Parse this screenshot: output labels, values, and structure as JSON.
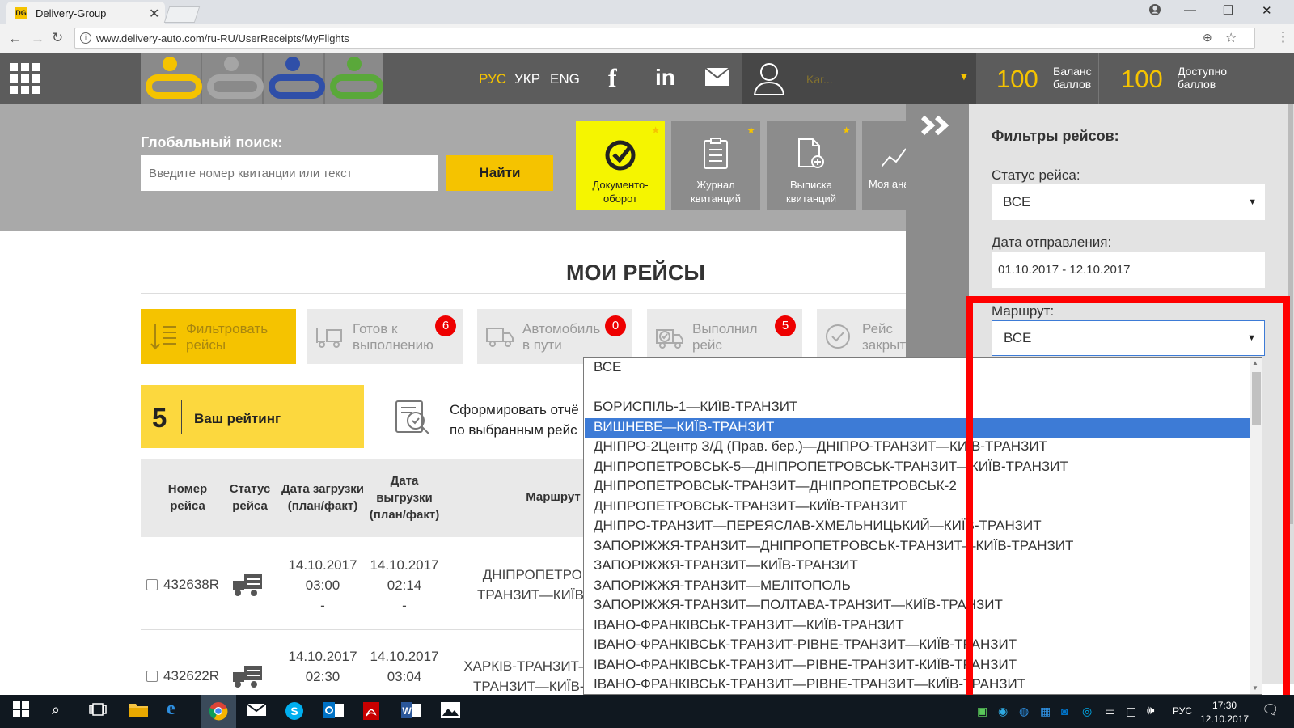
{
  "browser": {
    "tab_title": "Delivery-Group",
    "favicon_text": "DG",
    "url": "www.delivery-auto.com/ru-RU/UserReceipts/MyFlights"
  },
  "header": {
    "languages": [
      "РУС",
      "УКР",
      "ENG"
    ],
    "active_language": "РУС",
    "username_masked": "Kar...",
    "balance": {
      "value": "100",
      "label_line1": "Баланс",
      "label_line2": "баллов"
    },
    "available": {
      "value": "100",
      "label_line1": "Доступно",
      "label_line2": "баллов"
    },
    "accent_color": "#f5c300"
  },
  "search": {
    "label": "Глобальный поиск:",
    "placeholder": "Введите номер квитанции или текст",
    "button": "Найти"
  },
  "tiles": [
    {
      "line1": "Документо-",
      "line2": "оборот",
      "icon": "check-circle-icon"
    },
    {
      "line1": "Журнал",
      "line2": "квитанций",
      "icon": "clipboard-icon"
    },
    {
      "line1": "Выписка",
      "line2": "квитанций",
      "icon": "document-add-icon"
    },
    {
      "line1": "Моя ана",
      "line2": "",
      "icon": "chart-icon"
    }
  ],
  "page_title": "МОИ РЕЙСЫ",
  "status_buttons": [
    {
      "line1": "Фильтровать",
      "line2": "рейсы",
      "badge": ""
    },
    {
      "line1": "Готов к",
      "line2": "выполнению",
      "badge": "6"
    },
    {
      "line1": "Автомобиль",
      "line2": "в пути",
      "badge": "0"
    },
    {
      "line1": "Выполнил",
      "line2": "рейс",
      "badge": "5"
    },
    {
      "line1": "Рейс",
      "line2": "закрыт",
      "badge": ""
    }
  ],
  "rating": {
    "value": "5",
    "label": "Ваш рейтинг"
  },
  "report": {
    "line1": "Сформировать отчё",
    "line2": "по выбранным рейс"
  },
  "table": {
    "headers": [
      {
        "l1": "Номер",
        "l2": "рейса",
        "l3": ""
      },
      {
        "l1": "Статус",
        "l2": "рейса",
        "l3": ""
      },
      {
        "l1": "Дата загрузки",
        "l2": "(план/факт)",
        "l3": ""
      },
      {
        "l1": "Дата",
        "l2": "выгрузки",
        "l3": "(план/факт)"
      },
      {
        "l1": "Маршрут",
        "l2": "",
        "l3": ""
      }
    ],
    "rows": [
      {
        "id": "432638R",
        "load_date": "14.10.2017",
        "load_time": "03:00",
        "load_fact": "-",
        "unload_date": "14.10.2017",
        "unload_time": "02:14",
        "unload_fact": "-",
        "route_l1": "ДНІПРОПЕТРОВ",
        "route_l2": "ТРАНЗИТ—КИЇВ-Т"
      },
      {
        "id": "432622R",
        "load_date": "14.10.2017",
        "load_time": "02:30",
        "load_fact": "",
        "unload_date": "14.10.2017",
        "unload_time": "03:04",
        "unload_fact": "",
        "route_l1": "ХАРКІВ-ТРАНЗИТ—П",
        "route_l2": "ТРАНЗИТ—КИЇВ-Т"
      }
    ]
  },
  "sidebar": {
    "title": "Фильтры рейсов:",
    "status_label": "Статус рейса:",
    "status_value": "ВСЕ",
    "date_label": "Дата отправления:",
    "date_value": "01.10.2017 - 12.10.2017",
    "route_label": "Маршрут:",
    "route_value": "ВСЕ"
  },
  "route_dropdown": {
    "selected_index": 3,
    "options": [
      "ВСЕ",
      "",
      "БОРИСПІЛЬ-1—КИЇВ-ТРАНЗИТ",
      "ВИШНЕВЕ—КИЇВ-ТРАНЗИТ",
      "ДНІПРО-2Центр З/Д (Прав. бер.)—ДНІПРО-ТРАНЗИТ—КИЇВ-ТРАНЗИТ",
      "ДНІПРОПЕТРОВСЬК-5—ДНІПРОПЕТРОВСЬК-ТРАНЗИТ—КИЇВ-ТРАНЗИТ",
      "ДНІПРОПЕТРОВСЬК-ТРАНЗИТ—ДНІПРОПЕТРОВСЬК-2",
      "ДНІПРОПЕТРОВСЬК-ТРАНЗИТ—КИЇВ-ТРАНЗИТ",
      "ДНІПРО-ТРАНЗИТ—ПЕРЕЯСЛАВ-ХМЕЛЬНИЦЬКИЙ—КИЇВ-ТРАНЗИТ",
      "ЗАПОРІЖЖЯ-ТРАНЗИТ—ДНІПРОПЕТРОВСЬК-ТРАНЗИТ—КИЇВ-ТРАНЗИТ",
      "ЗАПОРІЖЖЯ-ТРАНЗИТ—КИЇВ-ТРАНЗИТ",
      "ЗАПОРІЖЖЯ-ТРАНЗИТ—МЕЛІТОПОЛЬ",
      "ЗАПОРІЖЖЯ-ТРАНЗИТ—ПОЛТАВА-ТРАНЗИТ—КИЇВ-ТРАНЗИТ",
      "ІВАНО-ФРАНКІВСЬК-ТРАНЗИТ—КИЇВ-ТРАНЗИТ",
      "ІВАНО-ФРАНКІВСЬК-ТРАНЗИТ-РІВНЕ-ТРАНЗИТ—КИЇВ-ТРАНЗИТ",
      "ІВАНО-ФРАНКІВСЬК-ТРАНЗИТ—РІВНЕ-ТРАНЗИТ-КИЇВ-ТРАНЗИТ",
      "ІВАНО-ФРАНКІВСЬК-ТРАНЗИТ—РІВНЕ-ТРАНЗИТ—КИЇВ-ТРАНЗИТ"
    ]
  },
  "taskbar": {
    "language": "РУС",
    "time": "17:30",
    "date": "12.10.2017"
  },
  "colors": {
    "highlight": "#3d7bd6",
    "badge": "#e00000",
    "annotation_box": "#ff0000"
  }
}
